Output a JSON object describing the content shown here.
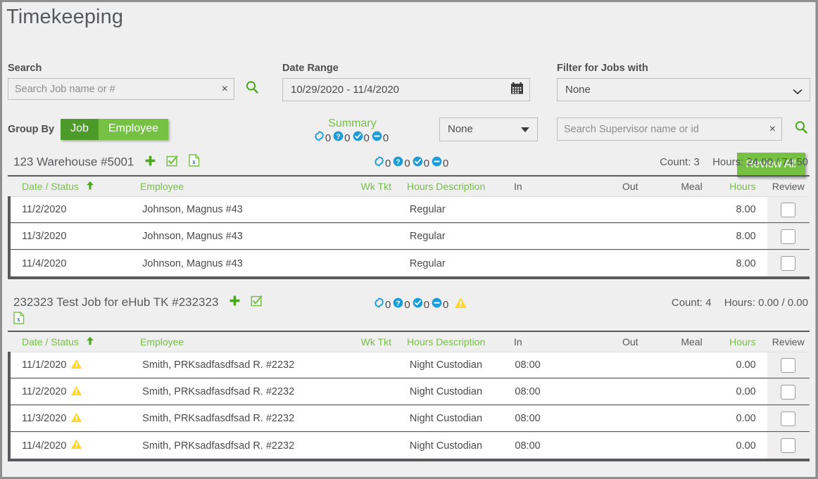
{
  "page": {
    "title": "Timekeeping"
  },
  "search": {
    "label": "Search",
    "placeholder": "Search Job name or #",
    "value": "",
    "clear": "×",
    "search_icon": "magnifier-icon"
  },
  "group_by": {
    "label": "Group By",
    "options": [
      "Job",
      "Employee"
    ],
    "selected": "Employee"
  },
  "date_range": {
    "label": "Date Range",
    "value": "10/29/2020 - 11/4/2020",
    "calendar_icon": "calendar-icon"
  },
  "summary": {
    "title": "Summary",
    "statuses": [
      {
        "icon": "gear-outline-icon",
        "count": "0",
        "color": "#1b9dd9"
      },
      {
        "icon": "question-circle-icon",
        "count": "0",
        "color": "#1b9dd9"
      },
      {
        "icon": "check-circle-icon",
        "count": "0",
        "color": "#1b9dd9"
      },
      {
        "icon": "minus-circle-icon",
        "count": "0",
        "color": "#1b9dd9"
      }
    ]
  },
  "mid_select": {
    "value": "None"
  },
  "job_filter": {
    "label": "Filter for Jobs with",
    "value": "None",
    "supervisor_placeholder": "Search Supervisor name or id",
    "supervisor_value": "",
    "clear": "×"
  },
  "review_all": {
    "label": "Review All"
  },
  "columns": [
    {
      "key": "date",
      "label": "Date / Status",
      "sortable": true,
      "sorted": "asc"
    },
    {
      "key": "emp",
      "label": "Employee",
      "sortable": true
    },
    {
      "key": "wk",
      "label": "Wk Tkt",
      "sortable": true
    },
    {
      "key": "desc",
      "label": "Hours Description",
      "sortable": true
    },
    {
      "key": "in",
      "label": "In",
      "sortable": false
    },
    {
      "key": "out",
      "label": "Out",
      "sortable": false
    },
    {
      "key": "meal",
      "label": "Meal",
      "sortable": false
    },
    {
      "key": "hours",
      "label": "Hours",
      "sortable": true
    },
    {
      "key": "rev",
      "label": "Review",
      "sortable": false
    }
  ],
  "groups": [
    {
      "title": "123 Warehouse #5001",
      "actions": [
        "plus-icon",
        "check-square-icon",
        "excel-export-icon"
      ],
      "statuses": [
        {
          "icon": "gear-outline-icon",
          "count": "0"
        },
        {
          "icon": "question-circle-icon",
          "count": "0"
        },
        {
          "icon": "check-circle-icon",
          "count": "0"
        },
        {
          "icon": "minus-circle-icon",
          "count": "0"
        }
      ],
      "warning": false,
      "count_label": "Count: 3",
      "hours_label": "Hours: 24.00 / 74.50",
      "rows": [
        {
          "date": "11/2/2020",
          "warn": false,
          "emp": "Johnson, Magnus #43",
          "wk": "",
          "desc": "Regular",
          "in": "",
          "out": "",
          "meal": "",
          "hours": "8.00",
          "checked": false
        },
        {
          "date": "11/3/2020",
          "warn": false,
          "emp": "Johnson, Magnus #43",
          "wk": "",
          "desc": "Regular",
          "in": "",
          "out": "",
          "meal": "",
          "hours": "8.00",
          "checked": false
        },
        {
          "date": "11/4/2020",
          "warn": false,
          "emp": "Johnson, Magnus #43",
          "wk": "",
          "desc": "Regular",
          "in": "",
          "out": "",
          "meal": "",
          "hours": "8.00",
          "checked": false
        }
      ]
    },
    {
      "title": "232323 Test Job for eHub TK #232323",
      "actions": [
        "plus-icon",
        "check-square-icon",
        "excel-export-icon"
      ],
      "statuses": [
        {
          "icon": "gear-outline-icon",
          "count": "0"
        },
        {
          "icon": "question-circle-icon",
          "count": "0"
        },
        {
          "icon": "check-circle-icon",
          "count": "0"
        },
        {
          "icon": "minus-circle-icon",
          "count": "0"
        }
      ],
      "warning": true,
      "count_label": "Count: 4",
      "hours_label": "Hours: 0.00 / 0.00",
      "rows": [
        {
          "date": "11/1/2020",
          "warn": true,
          "emp": "Smith, PRKsadfasdfsad R. #2232",
          "wk": "",
          "desc": "Night Custodian",
          "in": "08:00",
          "out": "",
          "meal": "",
          "hours": "0.00",
          "checked": false
        },
        {
          "date": "11/2/2020",
          "warn": true,
          "emp": "Smith, PRKsadfasdfsad R. #2232",
          "wk": "",
          "desc": "Night Custodian",
          "in": "08:00",
          "out": "",
          "meal": "",
          "hours": "0.00",
          "checked": false
        },
        {
          "date": "11/3/2020",
          "warn": true,
          "emp": "Smith, PRKsadfasdfsad R. #2232",
          "wk": "",
          "desc": "Night Custodian",
          "in": "08:00",
          "out": "",
          "meal": "",
          "hours": "0.00",
          "checked": false
        },
        {
          "date": "11/4/2020",
          "warn": true,
          "emp": "Smith, PRKsadfasdfsad R. #2232",
          "wk": "",
          "desc": "Night Custodian",
          "in": "08:00",
          "out": "",
          "meal": "",
          "hours": "0.00",
          "checked": false
        }
      ]
    }
  ],
  "colors": {
    "green": "#76c043",
    "dark_green": "#4c9a2a",
    "status_blue": "#1b9dd9",
    "warning_yellow": "#ffd633",
    "text_dark": "#58595b",
    "page_bg": "#efefef"
  }
}
